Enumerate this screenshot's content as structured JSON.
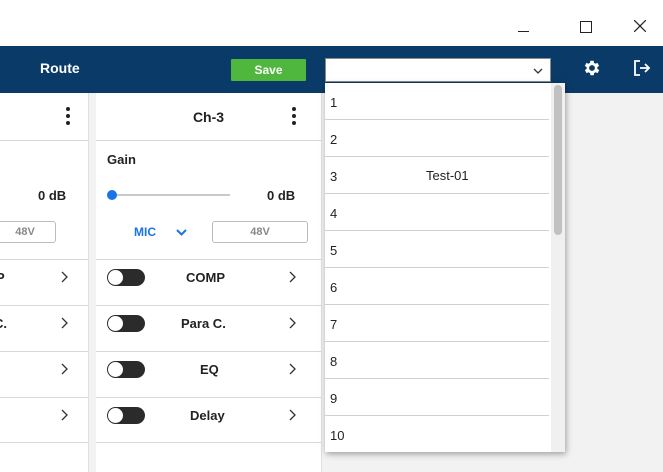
{
  "window": {
    "minimize_icon": "minimize-icon",
    "maximize_icon": "maximize-icon",
    "close_icon": "close-icon"
  },
  "appbar": {
    "route_label": "Route",
    "save_label": "Save",
    "preset_value": "",
    "colors": {
      "bar": "#0a3b68",
      "save": "#4fb73e"
    }
  },
  "channels": {
    "left": {
      "db_value": "0  dB",
      "phantom_label": "48V",
      "fx": [
        {
          "label": "P"
        },
        {
          "label": "C."
        },
        {
          "label": ""
        },
        {
          "label": ""
        }
      ]
    },
    "ch3": {
      "title": "Ch-3",
      "gain_label": "Gain",
      "gain_db": "0  dB",
      "input_type": "MIC",
      "phantom_label": "48V",
      "fx": [
        {
          "label": "COMP"
        },
        {
          "label": "Para C."
        },
        {
          "label": "EQ"
        },
        {
          "label": "Delay"
        }
      ]
    }
  },
  "dropdown": {
    "items": [
      {
        "num": "1",
        "name": ""
      },
      {
        "num": "2",
        "name": ""
      },
      {
        "num": "3",
        "name": "Test-01"
      },
      {
        "num": "4",
        "name": ""
      },
      {
        "num": "5",
        "name": ""
      },
      {
        "num": "6",
        "name": ""
      },
      {
        "num": "7",
        "name": ""
      },
      {
        "num": "8",
        "name": ""
      },
      {
        "num": "9",
        "name": ""
      },
      {
        "num": "10",
        "name": ""
      }
    ]
  }
}
